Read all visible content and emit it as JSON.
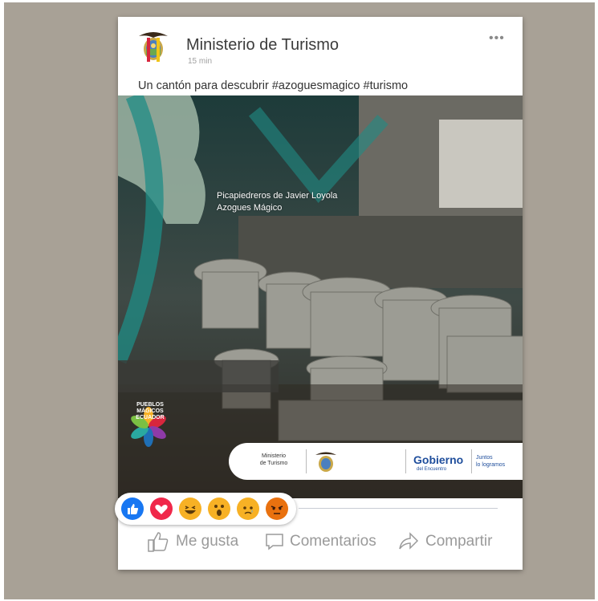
{
  "post": {
    "author": "Ministerio de Turismo",
    "time": "15 min",
    "more_label": "•••",
    "caption": "Un cantón para descubrir #azoguesmagico #turismo"
  },
  "photo": {
    "caption_line1": "Picapiedreros  de Javier Loyola",
    "caption_line2": "Azogues Mágico",
    "logo_text": [
      "PUEBLOS",
      "MÁGICOS",
      "ECUADOR"
    ],
    "banner": {
      "ministerio_line1": "Ministerio",
      "ministerio_line2": "de Turismo",
      "gobierno": "Gobierno",
      "gobierno_sub": "del Encuentro",
      "juntos_line1": "Juntos",
      "juntos_line2": "lo logramos"
    }
  },
  "reactions": [
    {
      "name": "like",
      "color": "#1877f2"
    },
    {
      "name": "love",
      "color": "#f0284a"
    },
    {
      "name": "haha",
      "color": "#f7b125"
    },
    {
      "name": "wow",
      "color": "#f7b125"
    },
    {
      "name": "sad",
      "color": "#f7b125"
    },
    {
      "name": "angry",
      "color": "#e9710f"
    }
  ],
  "actions": {
    "like": "Me gusta",
    "comment": "Comentarios",
    "share": "Compartir"
  },
  "colors": {
    "background_frame": "#a8a196",
    "teal_overlay": "#1f8c85",
    "text_gray": "#9a9a9a"
  }
}
